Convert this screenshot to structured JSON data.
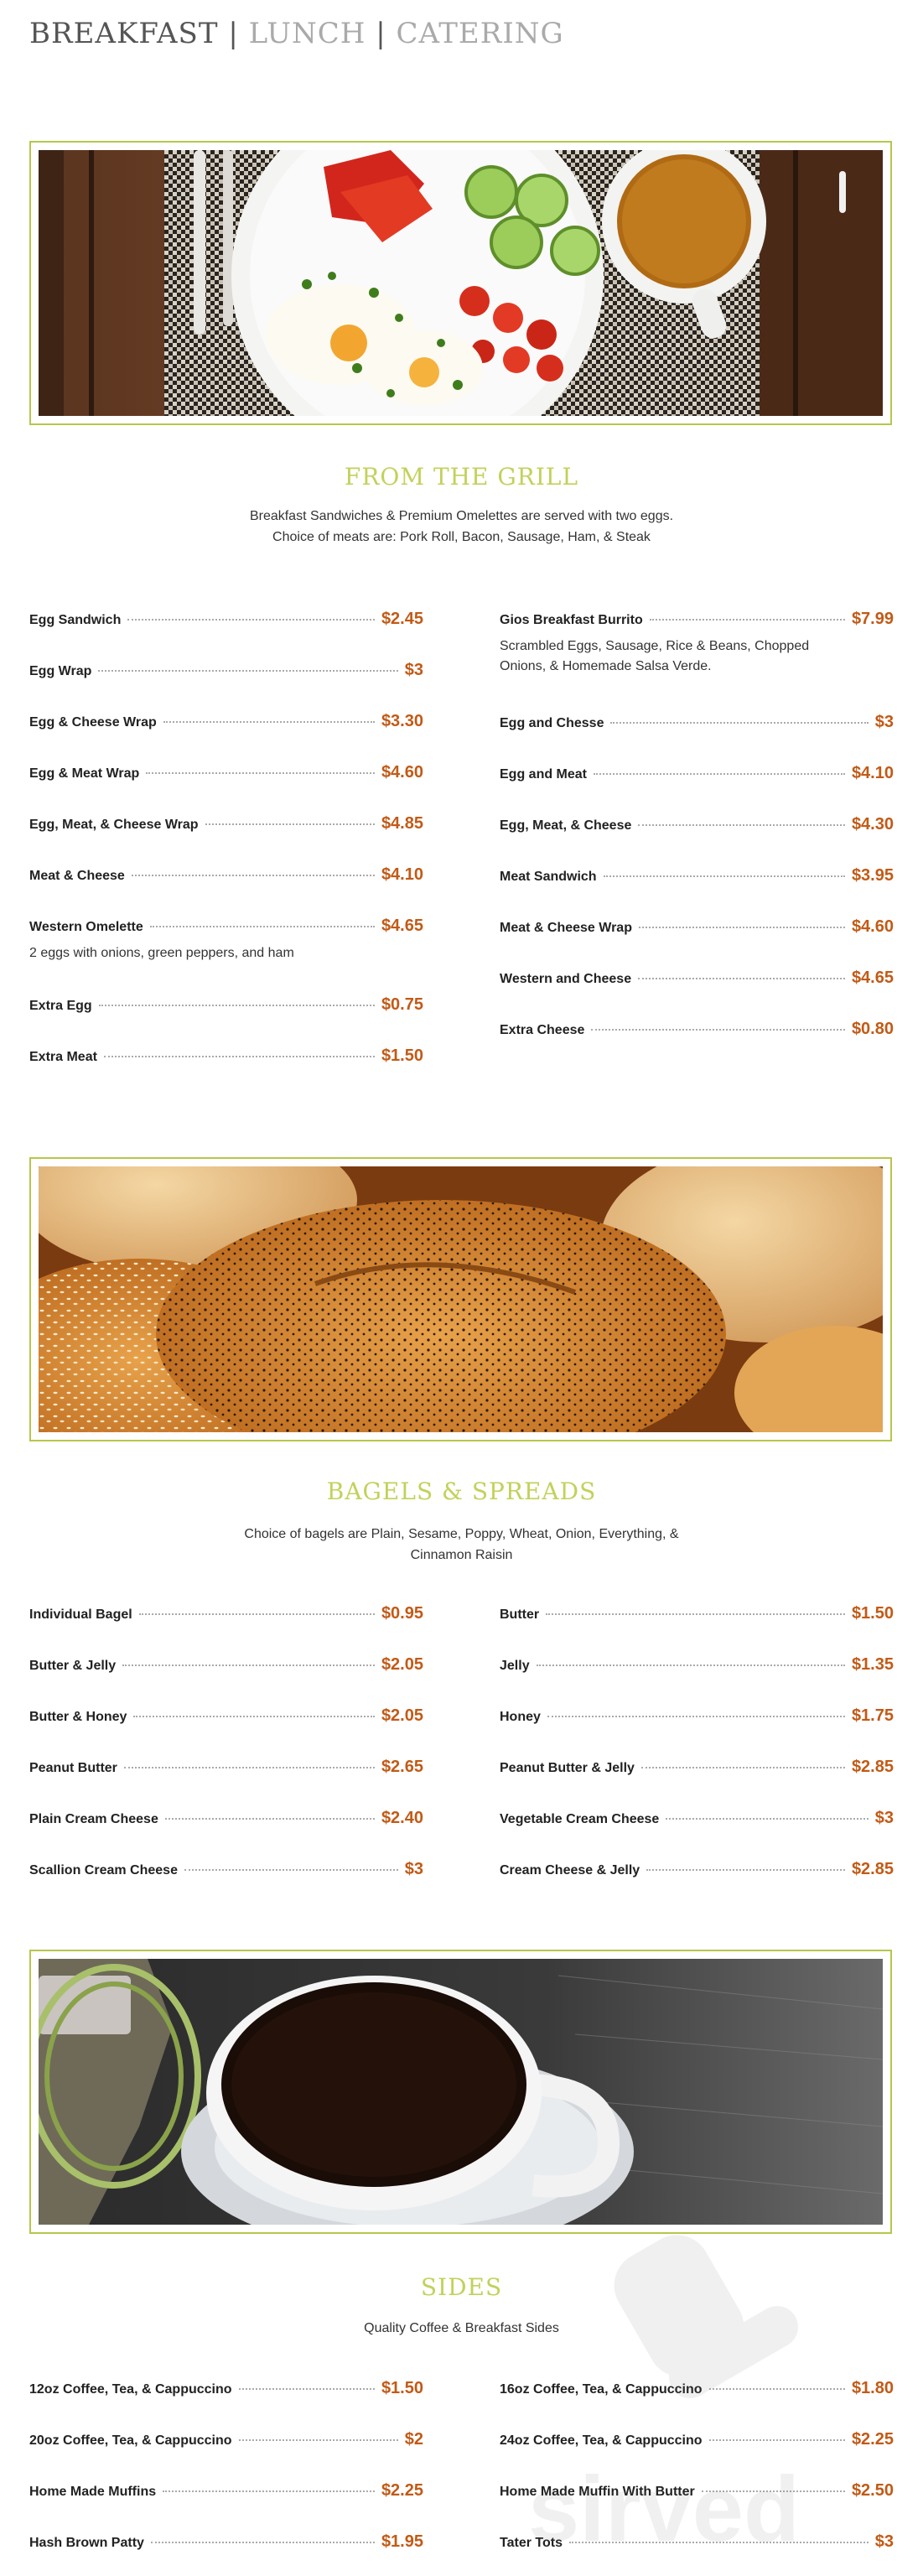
{
  "nav": {
    "breakfast": "BREAKFAST",
    "lunch": "LUNCH",
    "catering": "CATERING",
    "separator": "|"
  },
  "sections": {
    "grill": {
      "title": "FROM THE GRILL",
      "description": "Breakfast Sandwiches & Premium Omelettes are served with two eggs. Choice of meats are: Pork Roll, Bacon, Sausage, Ham, & Steak",
      "left_items": [
        {
          "name": "Egg Sandwich",
          "price": "$2.45"
        },
        {
          "name": "Egg Wrap",
          "price": "$3"
        },
        {
          "name": "Egg & Cheese Wrap",
          "price": "$3.30"
        },
        {
          "name": "Egg & Meat Wrap",
          "price": "$4.60"
        },
        {
          "name": "Egg, Meat, & Cheese Wrap",
          "price": "$4.85"
        },
        {
          "name": "Meat & Cheese",
          "price": "$4.10"
        },
        {
          "name": "Western Omelette",
          "price": "$4.65",
          "desc": "2 eggs with onions, green peppers, and ham"
        },
        {
          "name": "Extra Egg",
          "price": "$0.75"
        },
        {
          "name": "Extra Meat",
          "price": "$1.50"
        }
      ],
      "right_items": [
        {
          "name": "Gios Breakfast Burrito",
          "price": "$7.99",
          "desc": "Scrambled Eggs, Sausage, Rice & Beans, Chopped Onions, & Homemade Salsa Verde."
        },
        {
          "name": "Egg and Chesse",
          "price": "$3"
        },
        {
          "name": "Egg and Meat",
          "price": "$4.10"
        },
        {
          "name": "Egg, Meat, & Cheese",
          "price": "$4.30"
        },
        {
          "name": "Meat Sandwich",
          "price": "$3.95"
        },
        {
          "name": "Meat & Cheese Wrap",
          "price": "$4.60"
        },
        {
          "name": "Western and Cheese",
          "price": "$4.65"
        },
        {
          "name": "Extra Cheese",
          "price": "$0.80"
        }
      ]
    },
    "bagels": {
      "title": "BAGELS & SPREADS",
      "description": "Choice of bagels are Plain, Sesame, Poppy, Wheat, Onion, Everything, & Cinnamon Raisin",
      "left_items": [
        {
          "name": "Individual Bagel",
          "price": "$0.95"
        },
        {
          "name": "Butter & Jelly",
          "price": "$2.05"
        },
        {
          "name": "Butter & Honey",
          "price": "$2.05"
        },
        {
          "name": "Peanut Butter",
          "price": "$2.65"
        },
        {
          "name": "Plain Cream Cheese",
          "price": "$2.40"
        },
        {
          "name": "Scallion Cream Cheese",
          "price": "$3"
        }
      ],
      "right_items": [
        {
          "name": "Butter",
          "price": "$1.50"
        },
        {
          "name": "Jelly",
          "price": "$1.35"
        },
        {
          "name": "Honey",
          "price": "$1.75"
        },
        {
          "name": "Peanut Butter & Jelly",
          "price": "$2.85"
        },
        {
          "name": "Vegetable Cream Cheese",
          "price": "$3"
        },
        {
          "name": "Cream Cheese & Jelly",
          "price": "$2.85"
        }
      ]
    },
    "sides": {
      "title": "SIDES",
      "description": "Quality Coffee & Breakfast Sides",
      "left_items": [
        {
          "name": "12oz Coffee, Tea, & Cappuccino",
          "price": "$1.50"
        },
        {
          "name": "20oz Coffee, Tea, & Cappuccino",
          "price": "$2"
        },
        {
          "name": "Home Made Muffins",
          "price": "$2.25"
        },
        {
          "name": "Hash Brown Patty",
          "price": "$1.95"
        }
      ],
      "right_items": [
        {
          "name": "16oz Coffee, Tea, & Cappuccino",
          "price": "$1.80"
        },
        {
          "name": "24oz Coffee, Tea, & Cappuccino",
          "price": "$2.25"
        },
        {
          "name": "Home Made Muffin With Butter",
          "price": "$2.50"
        },
        {
          "name": "Tater Tots",
          "price": "$3"
        }
      ]
    }
  },
  "watermark": {
    "text": "sirved"
  },
  "colors": {
    "accent": "#c3d15a",
    "price": "#c25a16",
    "frame": "#b6c74a"
  }
}
